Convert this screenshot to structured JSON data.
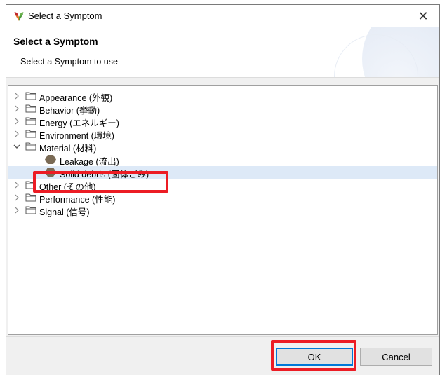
{
  "window": {
    "title": "Select a Symptom",
    "close_glyph": "✕"
  },
  "header": {
    "title": "Select a Symptom",
    "message": "Select a Symptom to use"
  },
  "tree": {
    "items": [
      {
        "label": "Appearance (外観)",
        "type": "folder",
        "expanded": false
      },
      {
        "label": "Behavior (挙動)",
        "type": "folder",
        "expanded": false
      },
      {
        "label": "Energy (エネルギー)",
        "type": "folder",
        "expanded": false
      },
      {
        "label": "Environment (環境)",
        "type": "folder",
        "expanded": false
      },
      {
        "label": "Material (材料)",
        "type": "folder",
        "expanded": true
      },
      {
        "label": "Leakage (流出)",
        "type": "symptom"
      },
      {
        "label": "Solid debris (固体ごみ)",
        "type": "symptom",
        "selected": true
      },
      {
        "label": "Other (その他)",
        "type": "folder",
        "expanded": false
      },
      {
        "label": "Performance (性能)",
        "type": "folder",
        "expanded": false
      },
      {
        "label": "Signal (信号)",
        "type": "folder",
        "expanded": false
      }
    ]
  },
  "buttons": {
    "ok": "OK",
    "cancel": "Cancel"
  },
  "icons": {
    "app": "app-logo-icon",
    "folder": "folder-icon",
    "symptom": "hexagon-symptom-icon",
    "collapsed": "chevron-right-icon",
    "expanded": "chevron-down-icon"
  },
  "colors": {
    "highlight": "#ec1c24",
    "selection": "#dde9f7",
    "symptom_icon": "#7a6a55"
  }
}
